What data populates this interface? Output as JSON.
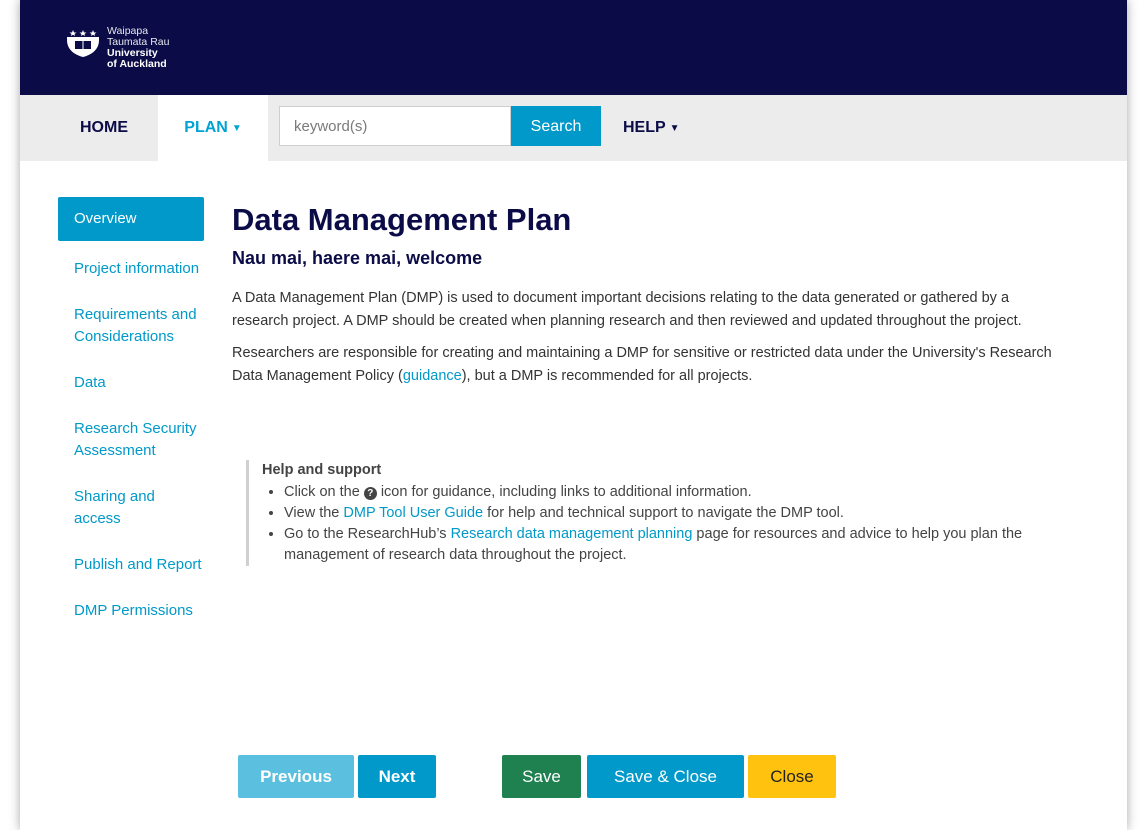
{
  "brand": {
    "line1": "Waipapa",
    "line2": "Taumata Rau",
    "line3": "University",
    "line4": "of Auckland",
    "colors": {
      "navy": "#0b0c47",
      "accent": "#0099c9",
      "save": "#1f8050",
      "close": "#ffc20e"
    }
  },
  "nav": {
    "home": "HOME",
    "plan": "PLAN",
    "search_placeholder": "keyword(s)",
    "search_button": "Search",
    "help": "HELP",
    "caret_icon": "caret-down-icon"
  },
  "sidebar": {
    "items": [
      {
        "label": "Overview",
        "active": true
      },
      {
        "label": "Project information"
      },
      {
        "label": "Requirements and Considerations"
      },
      {
        "label": "Data"
      },
      {
        "label": "Research Security Assessment"
      },
      {
        "label": "Sharing and access"
      },
      {
        "label": "Publish and Report"
      },
      {
        "label": "DMP Permissions"
      }
    ]
  },
  "main": {
    "title": "Data Management Plan",
    "subtitle": "Nau mai, haere mai, welcome",
    "para1": "A Data Management Plan (DMP) is used to document important decisions relating to the data generated or gathered by a research project. A DMP should be created when planning research and then reviewed and updated throughout the project.",
    "para2_before": "Researchers are responsible for creating and maintaining a DMP for sensitive or restricted data under the University's Research Data Management Policy (",
    "para2_link": "guidance",
    "para2_after": "), but a DMP is recommended for all projects."
  },
  "help": {
    "title": "Help and support",
    "item1_before": "Click on the ",
    "item1_icon": "?",
    "item1_after": " icon for guidance, including links to additional information.",
    "item2_before": "View the ",
    "item2_link": "DMP Tool User Guide",
    "item2_after": " for help and technical support to navigate the DMP tool.",
    "item3_before": "Go to the ResearchHub’s ",
    "item3_link": "Research data management planning",
    "item3_after": " page for resources and advice to help you plan the management of research data throughout the project."
  },
  "buttons": {
    "previous": "Previous",
    "next": "Next",
    "save": "Save",
    "save_close": "Save & Close",
    "close": "Close"
  }
}
